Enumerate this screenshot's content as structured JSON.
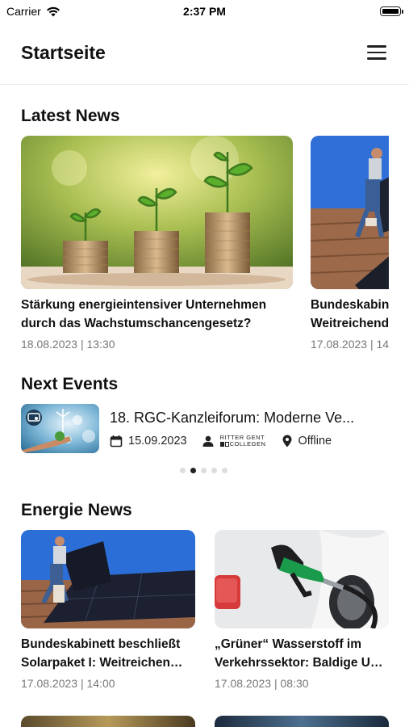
{
  "status_bar": {
    "carrier": "Carrier",
    "time": "2:37 PM"
  },
  "header": {
    "title": "Startseite"
  },
  "latest_news": {
    "title": "Latest News",
    "items": [
      {
        "title_line1": "Stärkung energieintensiver Unternehmen",
        "title_line2": "durch das Wachstumschancengesetz?",
        "date": "18.08.2023 | 13:30"
      },
      {
        "title_line1": "Bundeskabin",
        "title_line2": "Weitreichend",
        "date": "17.08.2023 | 14"
      }
    ]
  },
  "next_events": {
    "title": "Next Events",
    "items": [
      {
        "title": "18. RGC-Kanzleiforum: Moderne Ve...",
        "date": "15.09.2023",
        "organizer_top": "RITTER GENT",
        "organizer_bottom": "COLLEGEN",
        "location": "Offline"
      }
    ],
    "pager": {
      "count": 5,
      "active": 2
    }
  },
  "energie_news": {
    "title": "Energie News",
    "items": [
      {
        "title_line1": "Bundeskabinett beschließt",
        "title_line2": "Solarpaket I: Weitreichen…",
        "date": "17.08.2023 | 14:00"
      },
      {
        "title_line1": "„Grüner“ Wasserstoff im",
        "title_line2": "Verkehrssektor: Baldige U…",
        "date": "17.08.2023 | 08:30"
      }
    ]
  },
  "colors": {
    "text": "#111111",
    "muted": "#777777",
    "divider": "#ececec",
    "dot_active": "#222222",
    "dot_inactive": "#dddddd"
  }
}
